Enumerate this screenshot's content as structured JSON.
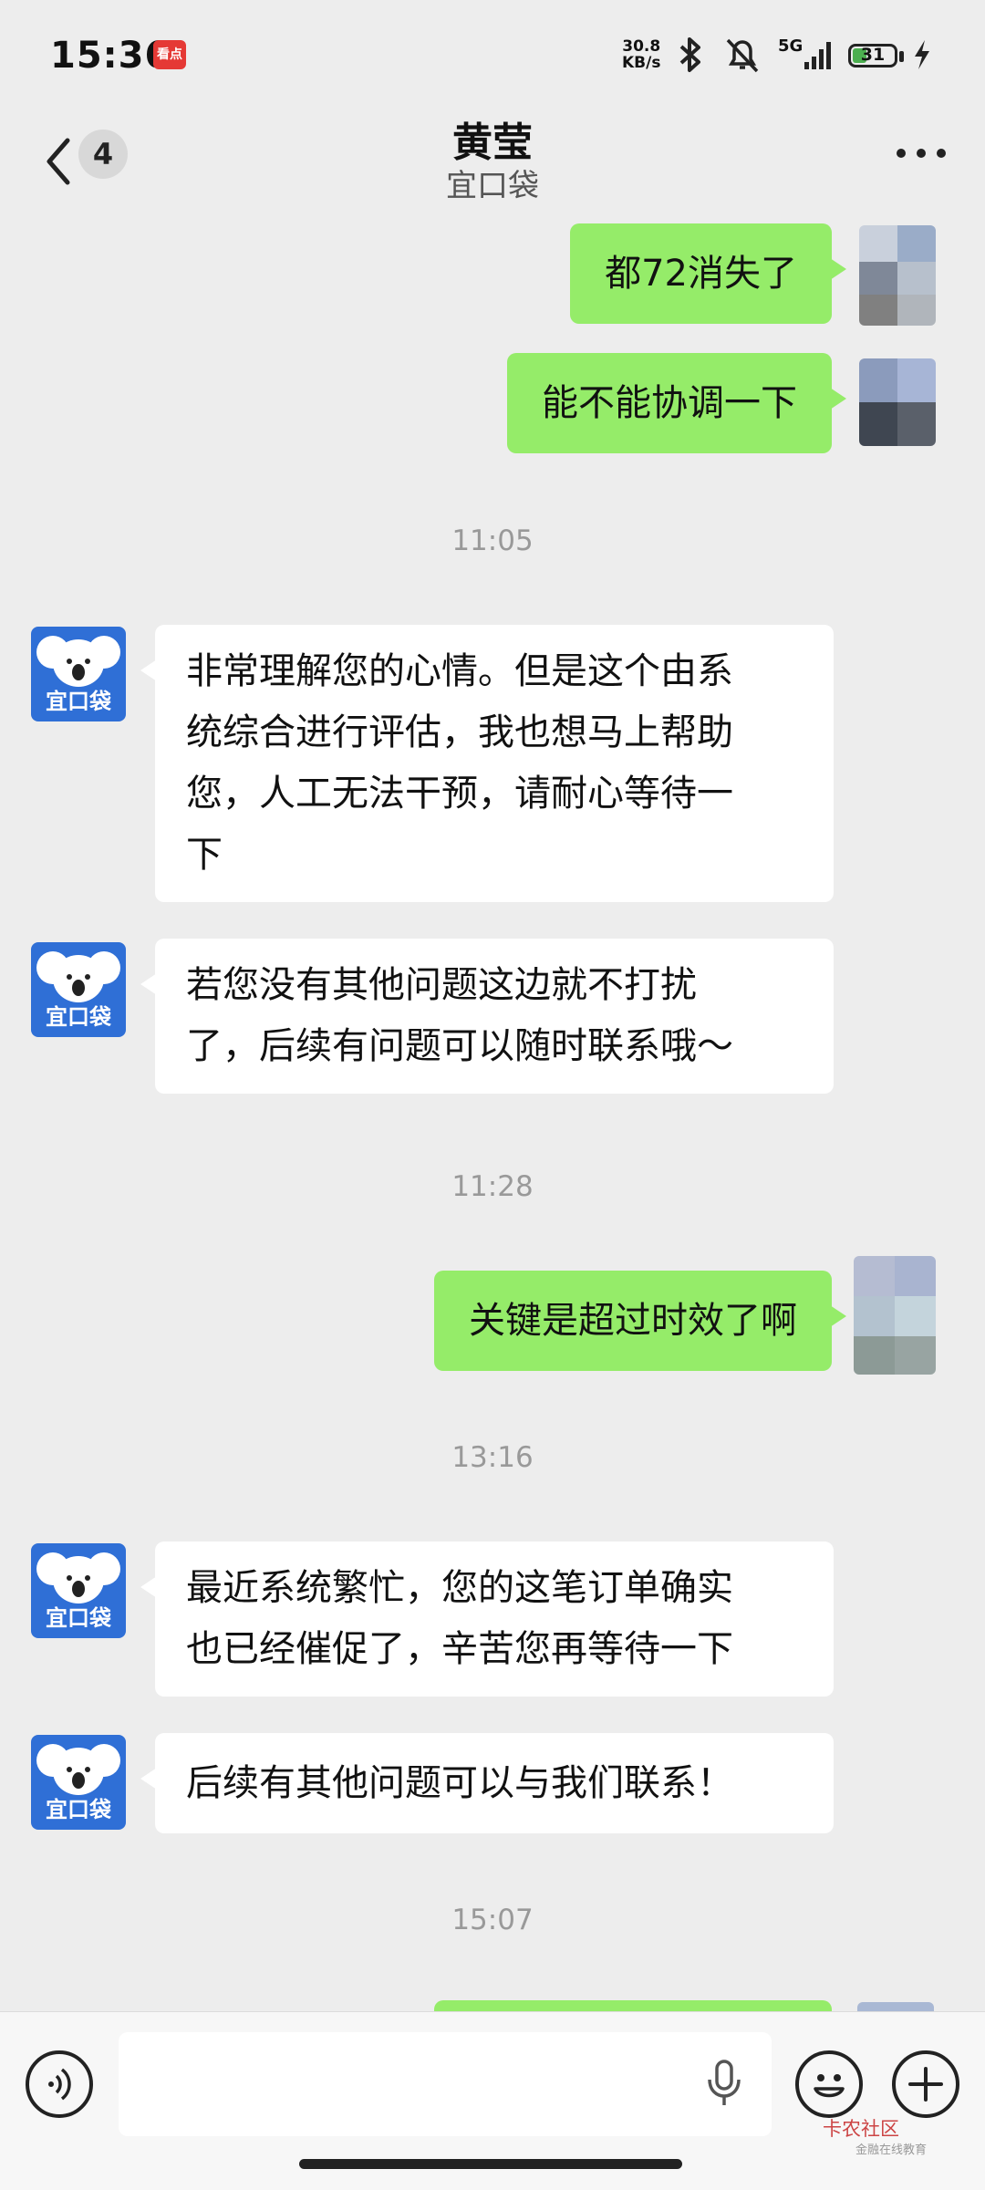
{
  "status_bar": {
    "time": "15:36",
    "news_app_label": "看点",
    "net_speed_value": "30.8",
    "net_speed_unit": "KB/s",
    "signal_label": "5G",
    "battery_level": "31",
    "icons": [
      "bluetooth-icon",
      "mute-icon",
      "signal-icon",
      "battery-icon",
      "charging-icon"
    ]
  },
  "header": {
    "unread_count": "4",
    "title": "黄莹",
    "subtitle": "宜口袋"
  },
  "bot_avatar_label": "宜口袋",
  "messages": [
    {
      "sender": "me",
      "text": "都72消失了"
    },
    {
      "sender": "me",
      "text": "能不能协调一下"
    },
    {
      "time": "11:05"
    },
    {
      "sender": "them",
      "lines": [
        "非常理解您的心情。但是这个由系",
        "统综合进行评估，我也想马上帮助",
        "您，人工无法干预，请耐心等待一",
        "下"
      ]
    },
    {
      "sender": "them",
      "lines": [
        "若您没有其他问题这边就不打扰",
        "了，后续有问题可以随时联系哦～"
      ]
    },
    {
      "time": "11:28"
    },
    {
      "sender": "me",
      "text": "关键是超过时效了啊"
    },
    {
      "time": "13:16"
    },
    {
      "sender": "them",
      "lines": [
        "最近系统繁忙，您的这笔订单确实",
        "也已经催促了，辛苦您再等待一下"
      ]
    },
    {
      "sender": "them",
      "lines": [
        "后续有其他问题可以与我们联系！"
      ]
    },
    {
      "time": "15:07"
    }
  ],
  "input_bar": {
    "placeholder": "",
    "watermark": "卡农社区",
    "watermark_sub": "金融在线教育"
  },
  "colors": {
    "my_bubble": "#95ec69",
    "their_bubble": "#ffffff",
    "background": "#ededed",
    "bot_avatar": "#2f6fd6"
  }
}
